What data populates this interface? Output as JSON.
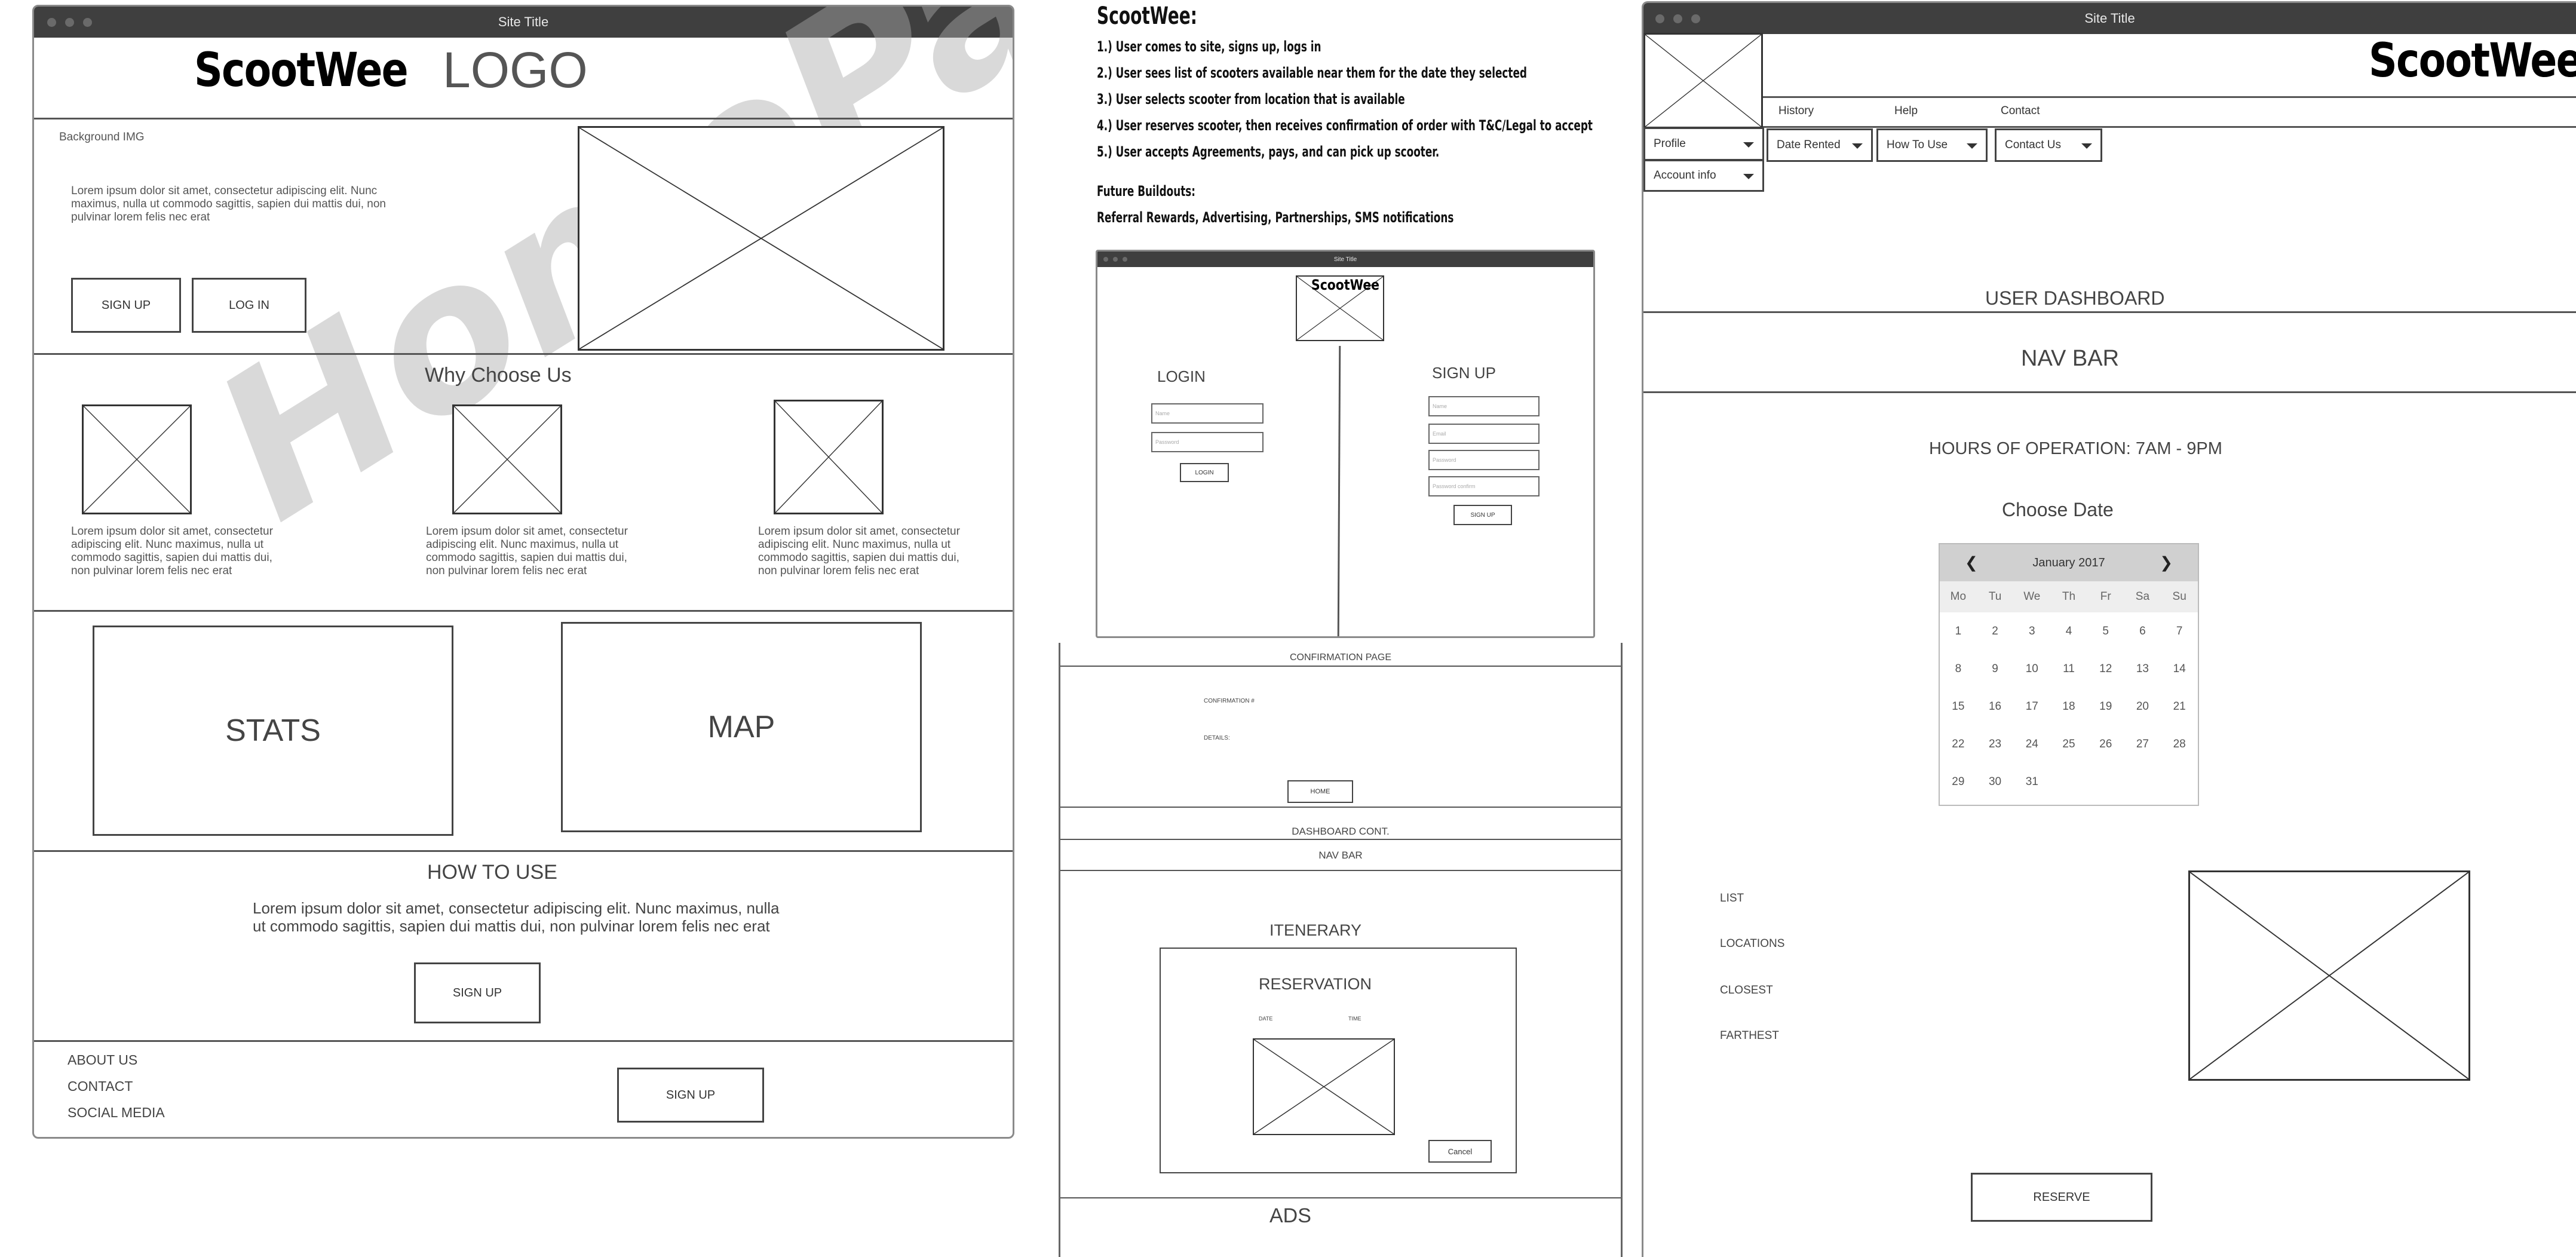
{
  "home": {
    "window_title": "Site Title",
    "brand": "ScootWee",
    "logo": "LOGO",
    "hero": {
      "bg_label": "Background IMG",
      "text": "Lorem ipsum dolor sit amet, consectetur adipiscing elit. Nunc maximus, nulla ut commodo sagittis, sapien dui mattis dui, non pulvinar lorem felis nec erat",
      "signup_label": "SIGN UP",
      "login_label": "LOG IN"
    },
    "why": {
      "title": "Why Choose Us",
      "items": [
        "Lorem ipsum dolor sit amet, consectetur adipiscing elit. Nunc maximus, nulla ut commodo sagittis, sapien dui mattis dui, non pulvinar lorem felis nec erat",
        "Lorem ipsum dolor sit amet, consectetur adipiscing elit. Nunc maximus, nulla ut commodo sagittis, sapien dui mattis dui, non pulvinar lorem felis nec erat",
        "Lorem ipsum dolor sit amet, consectetur adipiscing elit. Nunc maximus, nulla ut commodo sagittis, sapien dui mattis dui, non pulvinar lorem felis nec erat"
      ]
    },
    "stats_label": "STATS",
    "map_label": "MAP",
    "how": {
      "title": "HOW TO USE",
      "text": "Lorem ipsum dolor sit amet, consectetur adipiscing elit. Nunc maximus, nulla ut commodo sagittis, sapien dui mattis dui, non pulvinar lorem felis nec erat",
      "signup_label": "SIGN UP"
    },
    "footer": {
      "links": [
        "ABOUT US",
        "CONTACT",
        "SOCIAL MEDIA"
      ],
      "signup_label": "SIGN UP"
    },
    "watermark": "HomePage"
  },
  "notes": {
    "title": "ScootWee:",
    "steps": [
      "1.) User comes to site, signs up, logs in",
      "2.) User sees list of scooters available near them for the date they selected",
      "3.) User selects scooter from location that is available",
      "4.) User reserves scooter, then receives confirmation of order with T&C/Legal to accept",
      "5.) User accepts Agreements, pays, and can pick up scooter."
    ],
    "future_title": "Future Buildouts:",
    "future_text": "Referral Rewards, Advertising, Partnerships, SMS notifications"
  },
  "auth": {
    "window_title": "Site Title",
    "brand": "ScootWee",
    "login": {
      "title": "LOGIN",
      "fields": [
        "Name",
        "Password"
      ],
      "button": "LOGIN"
    },
    "signup": {
      "title": "SIGN UP",
      "fields": [
        "Name",
        "Email",
        "Password",
        "Password confirm"
      ],
      "button": "SIGN UP"
    }
  },
  "confirmation": {
    "title": "CONFIRMATION PAGE",
    "number_label": "CONFIRMATION #",
    "details_label": "DETAILS:",
    "home_button": "HOME",
    "dash_cont": "DASHBOARD CONT.",
    "nav_bar": "NAV BAR",
    "itinerary": "ITENERARY",
    "reservation": "RESERVATION",
    "date_label": "DATE",
    "time_label": "TIME",
    "cancel_button": "Cancel",
    "ads": "ADS"
  },
  "dashboard": {
    "window_title": "Site Title",
    "brand": "ScootWee",
    "nav_links": [
      "History",
      "Help",
      "Contact"
    ],
    "profile_dropdown": "Profile",
    "account_dropdown": "Account info",
    "date_rented_dropdown": "Date Rented",
    "how_to_use_dropdown": "How To Use",
    "contact_us_dropdown": "Contact Us",
    "title": "USER DASHBOARD",
    "nav_bar": "NAV BAR",
    "hours": "HOURS OF OPERATION: 7AM - 9PM",
    "choose_date": "Choose Date",
    "calendar": {
      "month": "January 2017",
      "prev": "❮",
      "next": "❯",
      "dows": [
        "Mo",
        "Tu",
        "We",
        "Th",
        "Fr",
        "Sa",
        "Su"
      ],
      "days": [
        "1",
        "2",
        "3",
        "4",
        "5",
        "6",
        "7",
        "8",
        "9",
        "10",
        "11",
        "12",
        "13",
        "14",
        "15",
        "16",
        "17",
        "18",
        "19",
        "20",
        "21",
        "22",
        "23",
        "24",
        "25",
        "26",
        "27",
        "28",
        "29",
        "30",
        "31"
      ]
    },
    "filters": [
      "LIST",
      "LOCATIONS",
      "CLOSEST",
      "FARTHEST"
    ],
    "reserve_button": "RESERVE"
  }
}
